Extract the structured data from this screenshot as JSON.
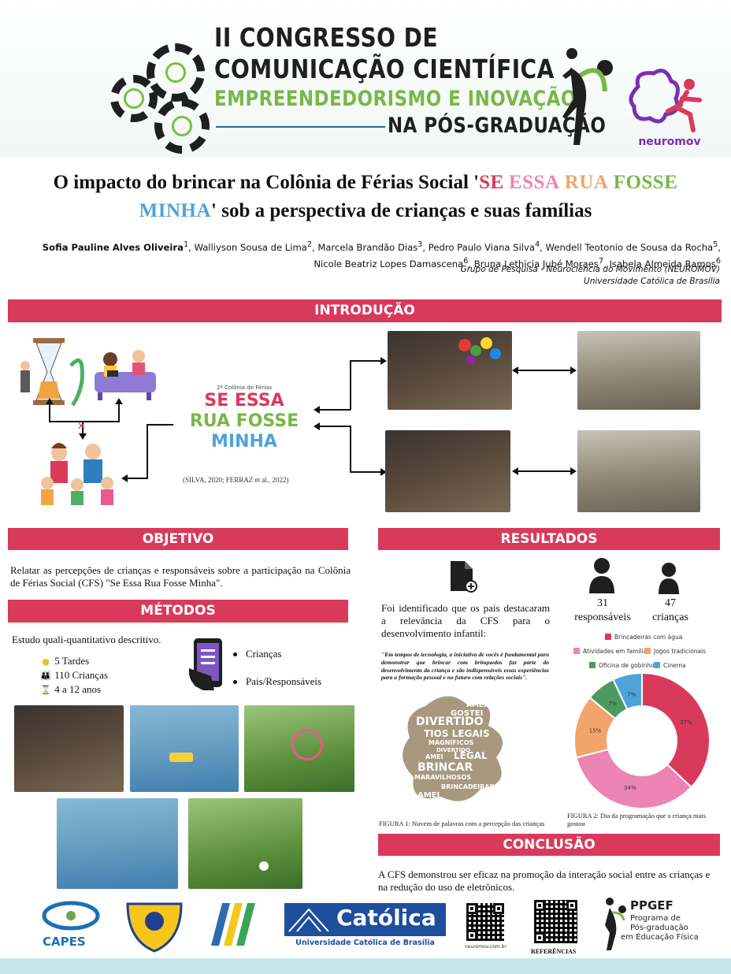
{
  "header": {
    "line1": "II CONGRESSO DE",
    "line2": "COMUNICAÇÃO CIENTÍFICA",
    "line3": "EMPREENDEDORISMO E INOVAÇÃO",
    "line4": "NA PÓS-GRADUAÇÃO",
    "lab_name": "neuromov"
  },
  "title": {
    "part1": "O impacto do brincar na Colônia de Férias Social '",
    "hl_words": [
      "SE",
      "ESSA",
      "RUA",
      "FOSSE",
      "MINHA"
    ],
    "part2": "' sob a perspectiva de crianças e suas famílias"
  },
  "authors": [
    {
      "name": "Sofia Pauline Alves Oliveira",
      "sup": "1",
      "lead": true
    },
    {
      "name": "Walliyson Sousa de Lima",
      "sup": "2"
    },
    {
      "name": "Marcela Brandão Dias",
      "sup": "3"
    },
    {
      "name": "Pedro Paulo Viana Silva",
      "sup": "4"
    },
    {
      "name": "Wendell Teotonio de Sousa da Rocha",
      "sup": "5"
    },
    {
      "name": "Nicole Beatriz Lopes Damascena",
      "sup": "6"
    },
    {
      "name": "Bruna Lethicia Jubé Moraes",
      "sup": "7"
    },
    {
      "name": "Isabela Almeida Ramos",
      "sup": "6"
    }
  ],
  "affiliation": {
    "group": "Grupo de Pesquisa - Neurociência do Movimento (NEUROMOV)",
    "university": "Universidade Católica de Brasília"
  },
  "sections": {
    "intro": "INTRODUÇÃO",
    "objetivo": "OBJETIVO",
    "metodos": "MÉTODOS",
    "resultados": "RESULTADOS",
    "conclusao": "CONCLUSÃO"
  },
  "intro": {
    "event_edition": "2ª Colônia de Férias",
    "event_line1": "SE ESSA",
    "event_line2": "RUA FOSSE",
    "event_line3": "MINHA",
    "citation": "(SILVA, 2020; FERRAZ et al., 2022)"
  },
  "objetivo": {
    "text": "Relatar as percepções de crianças e responsáveis sobre a participação na Colônia de Férias Social (CFS) \"Se Essa Rua Fosse Minha\"."
  },
  "metodos": {
    "design": "Estudo quali-quantitativo descritivo.",
    "stats": [
      {
        "icon": "sun-icon",
        "glyph": "●",
        "text": "5 Tardes"
      },
      {
        "icon": "people-icon",
        "glyph": "👪",
        "text": "110 Crianças"
      },
      {
        "icon": "hourglass-icon",
        "glyph": "⌛",
        "text": "4 a 12 anos"
      }
    ],
    "form_targets": [
      "Crianças",
      "Pais/Responsáveis"
    ]
  },
  "resultados": {
    "finding": "Foi identificado que os pais destacaram a relevância da CFS para o desenvolvimento infantil:",
    "quote": "\"Em tempos de tecnologia, a iniciativa de vocês é fundamental para demonstrar que brincar com brinquedos faz parte do desenvolvimento da criança e são indispensáveis essas experiências para a formação pessoal e no futuro com relações sociais\".",
    "respondents": [
      {
        "count": "31",
        "label": "responsáveis"
      },
      {
        "count": "47",
        "label": "crianças"
      }
    ],
    "cloud_words": [
      "AMEI",
      "GOSTEI",
      "DIVERTIDO",
      "TIOS LEGAIS",
      "MAGNÍFICOS",
      "DIVERTIDO",
      "AMEI",
      "LEGAL",
      "BRINCAR",
      "MARAVILHOSOS",
      "BRINCADEIRAS",
      "AMEI"
    ],
    "figure1_caption": "FIGURA 1: Nuvem de palavras com a percepção das crianças",
    "figure2_caption": "FIGURA 2: Dia da programação que a criança mais gostou"
  },
  "chart_data": {
    "type": "pie",
    "donut": true,
    "legend_position": "top",
    "categories": [
      "Brincadeiras com água",
      "Atividades em família",
      "Jogos tradicionais",
      "Oficina de gobinho",
      "Cinema"
    ],
    "values": [
      37,
      34,
      15,
      7,
      7
    ],
    "labels": [
      "37%",
      "34%",
      "15%",
      "7%",
      "7%"
    ],
    "colors": [
      "#d93a5c",
      "#ec84b4",
      "#f2a46b",
      "#4e9a5e",
      "#4fa3d9"
    ]
  },
  "conclusao": {
    "text": "A CFS demonstrou ser eficaz na promoção da interação social entre as crianças e na redução do uso de eletrônicos."
  },
  "footer": {
    "capes": "CAPES",
    "catolica": "Católica",
    "catolica_sub": "Universidade Católica de Brasília",
    "qr1_caption": "neuromov.com.br",
    "qr2_caption": "REFERÊNCIAS",
    "ppgef": "PPGEF",
    "ppgef_sub1": "Programa de",
    "ppgef_sub2": "Pós-graduação",
    "ppgef_sub3": "em Educação Física"
  },
  "colors": {
    "banner": "#d93a5c",
    "green": "#7ab648",
    "purple": "#7a2fb3",
    "footer_bar": "#c6e6ec"
  }
}
